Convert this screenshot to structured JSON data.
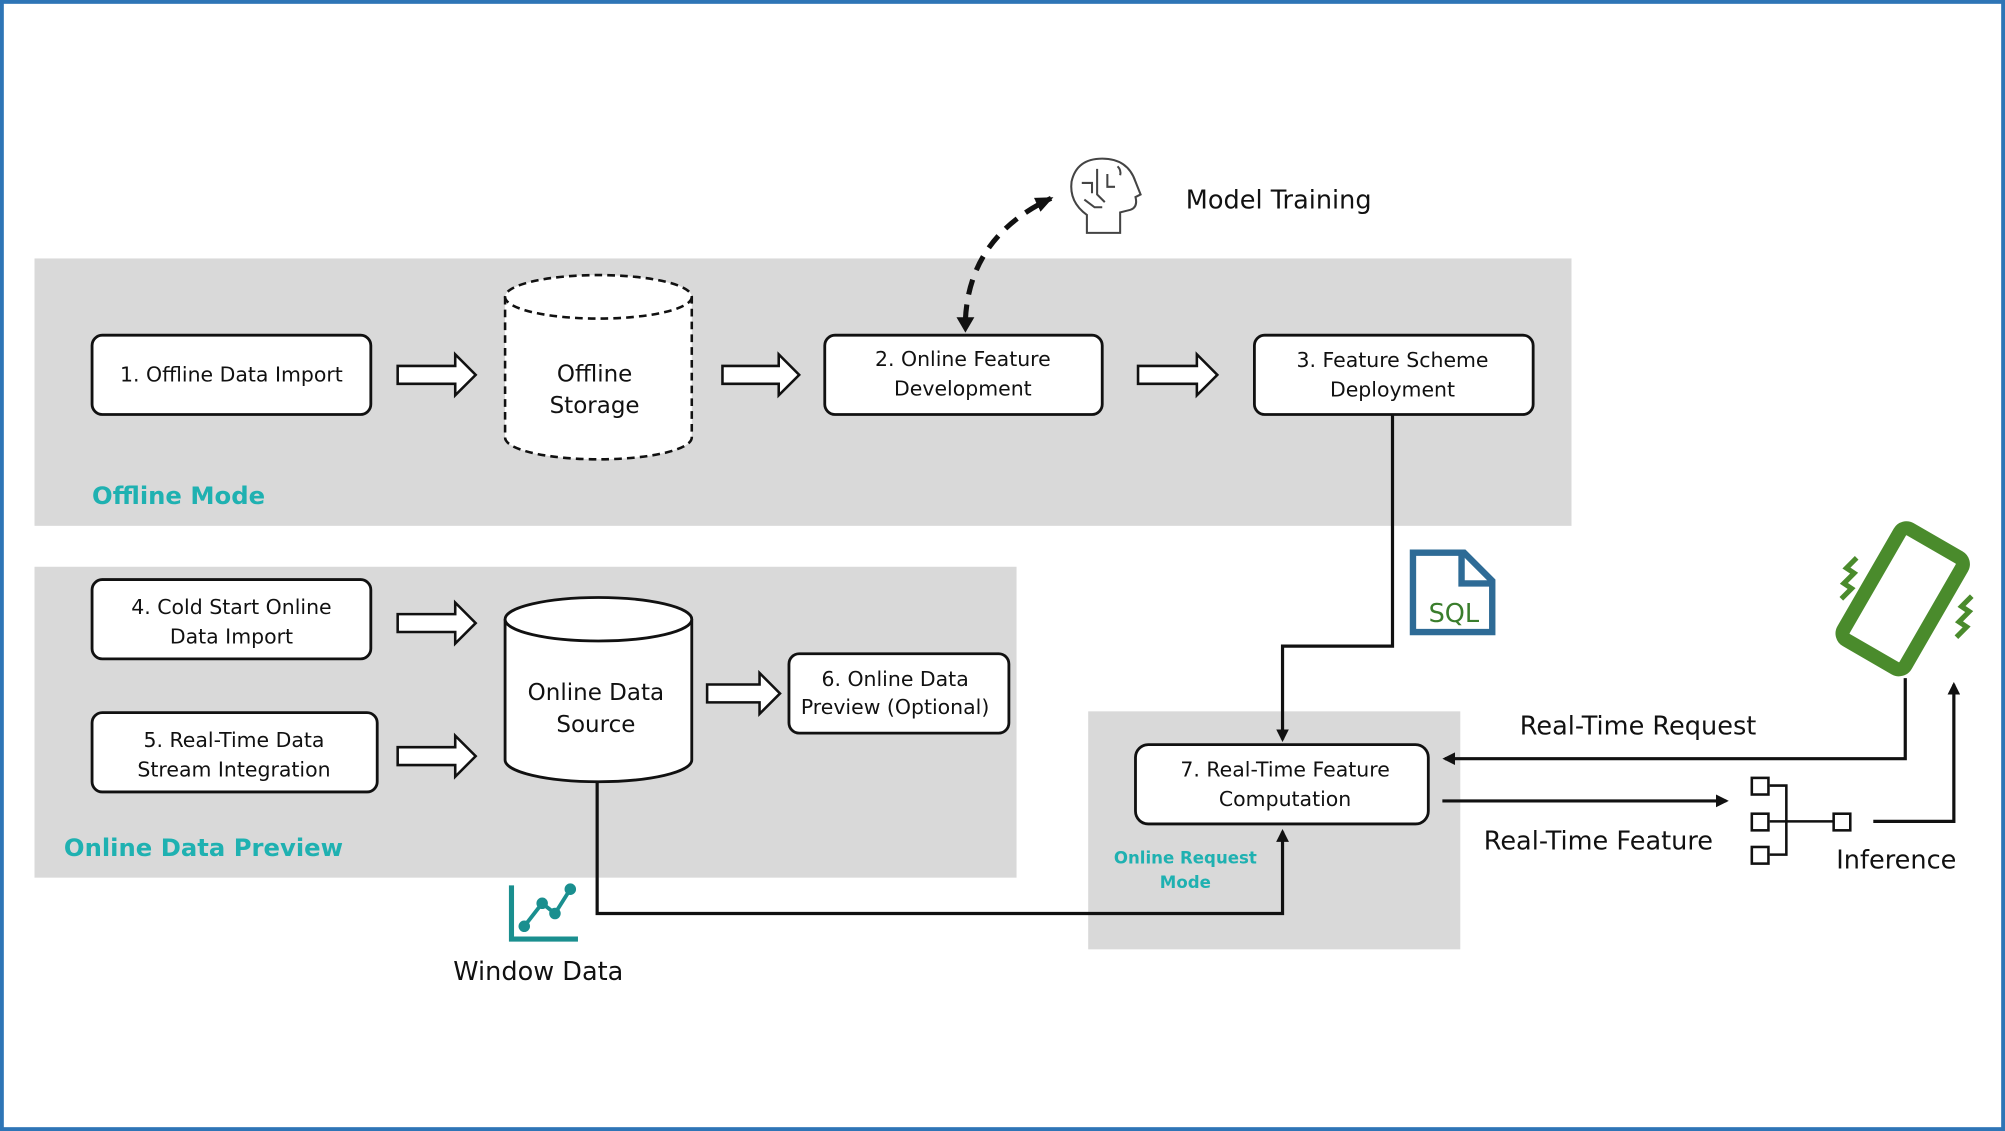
{
  "panels": {
    "offline_mode": "Offline Mode",
    "online_data_preview": "Online Data Preview",
    "online_request_mode": [
      "Online Request",
      "Mode"
    ]
  },
  "steps": {
    "s1": [
      "1. Offline Data Import"
    ],
    "s2": [
      "2. Online Feature",
      "Development"
    ],
    "s3": [
      "3. Feature Scheme",
      "Deployment"
    ],
    "s4": [
      "4. Cold Start Online",
      "Data Import"
    ],
    "s5": [
      "5. Real-Time Data",
      "Stream Integration"
    ],
    "s6": [
      "6. Online Data",
      "Preview (Optional)"
    ],
    "s7": [
      "7. Real-Time Feature",
      "Computation"
    ]
  },
  "stores": {
    "offline_storage": [
      "Offline",
      "Storage"
    ],
    "online_data_source": [
      "Online Data",
      "Source"
    ]
  },
  "labels": {
    "model_training": "Model Training",
    "window_data": "Window Data",
    "real_time_request": "Real-Time Request",
    "real_time_feature": "Real-Time Feature",
    "inference": "Inference",
    "sql": "SQL"
  },
  "colors": {
    "accent_teal": "#1fb1b1",
    "panel_gray": "#d9d9d9",
    "phone_green": "#4a8b2c",
    "sql_blue": "#2e6b96",
    "frame_blue": "#2e75b6"
  },
  "icons": [
    "brain-icon",
    "sql-file-icon",
    "phone-icon",
    "line-chart-icon",
    "network-icon"
  ]
}
